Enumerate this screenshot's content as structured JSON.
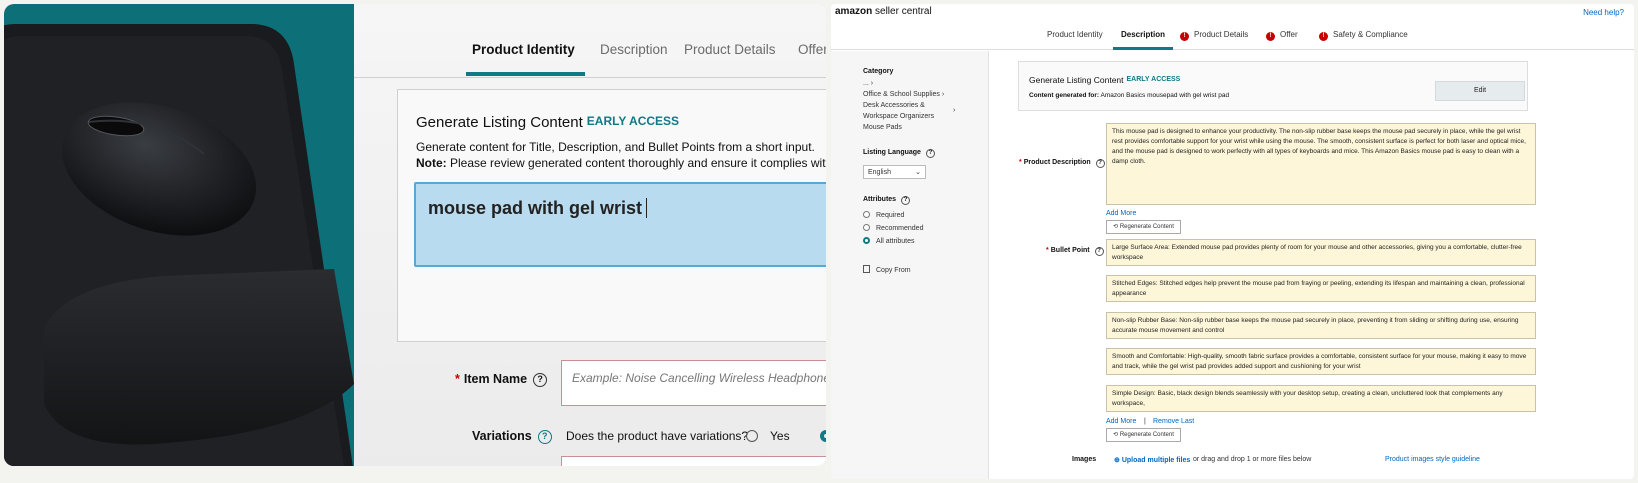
{
  "left": {
    "tabs": [
      "Product Identity",
      "Description",
      "Product Details",
      "Offer"
    ],
    "active_tab": "Product Identity",
    "generate": {
      "title": "Generate Listing Content",
      "badge": "EARLY ACCESS",
      "description": "Generate content for Title, Description, and Bullet Points from a short input.",
      "note_label": "Note:",
      "note_text": " Please review generated content thoroughly and ensure it complies with all",
      "input_value": "mouse pad with gel wrist"
    },
    "item_name": {
      "label": "Item Name",
      "placeholder": "Example: Noise Cancelling Wireless Headphones"
    },
    "variations": {
      "label": "Variations",
      "question": "Does the product have variations?",
      "yes": "Yes"
    }
  },
  "right": {
    "logo_brand": "amazon",
    "logo_text": " seller central",
    "help": "Need help?",
    "tabs": [
      {
        "label": "Product Identity",
        "error": false
      },
      {
        "label": "Description",
        "error": false
      },
      {
        "label": "Product Details",
        "error": true
      },
      {
        "label": "Offer",
        "error": true
      },
      {
        "label": "Safety & Compliance",
        "error": true
      }
    ],
    "active_tab": "Description",
    "sidebar": {
      "category_heading": "Category",
      "category_path": [
        "...",
        "Office & School Supplies",
        "Desk Accessories &",
        "Workspace Organizers",
        "Mouse Pads"
      ],
      "language_heading": "Listing Language",
      "language_value": "English",
      "attributes_heading": "Attributes",
      "attribute_options": [
        "Required",
        "Recommended",
        "All attributes"
      ],
      "attribute_selected": "All attributes",
      "copy_from": "Copy From"
    },
    "generate": {
      "title": "Generate Listing Content",
      "badge": "EARLY ACCESS",
      "for_label": "Content generated for:",
      "for_value": " Amazon Basics mousepad with gel wrist pad",
      "edit": "Edit"
    },
    "product_description": {
      "label": "Product Description",
      "value": "This mouse pad is designed to enhance your productivity. The non-slip rubber base keeps the mouse pad securely in place, while the gel wrist rest provides comfortable support for your wrist while using the mouse. The smooth, consistent surface is perfect for both laser and optical mice, and the mouse pad is designed to work perfectly with all types of keyboards and mice. This Amazon Basics mouse pad is easy to clean with a damp cloth."
    },
    "add_more": "Add More",
    "regenerate": "Regenerate Content",
    "bullet_point": {
      "label": "Bullet Point",
      "items": [
        "Large Surface Area: Extended mouse pad provides plenty of room for your mouse and other accessories, giving you a comfortable, clutter-free workspace",
        "Stitched Edges: Stitched edges help prevent the mouse pad from fraying or peeling, extending its lifespan and maintaining a clean, professional appearance",
        "Non-slip Rubber Base: Non-slip rubber base keeps the mouse pad securely in place, preventing it from sliding or shifting during use, ensuring accurate mouse movement and control",
        "Smooth and Comfortable: High-quality, smooth fabric surface provides a comfortable, consistent surface for your mouse, making it easy to move and track, while the gel wrist pad provides added support and cushioning for your wrist",
        "Simple Design: Basic, black design blends seamlessly with your desktop setup, creating a clean, uncluttered look that complements any workspace,"
      ]
    },
    "remove_last": "Remove Last",
    "separator": "|",
    "images": {
      "label": "Images",
      "upload": "Upload multiple files",
      "drag": " or drag and drop 1 or more files below",
      "guideline": "Product images style guideline"
    }
  }
}
